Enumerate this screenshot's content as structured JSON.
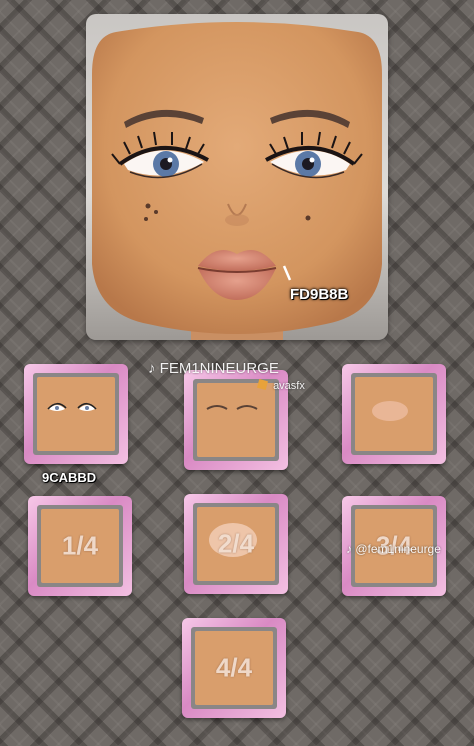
{
  "main_face": {
    "lip_color_code": "FD9B8B",
    "colors": {
      "skin": "#d99e6c",
      "lip": "#d27f6c",
      "iris": "#5b79a6"
    }
  },
  "tiles": [
    {
      "name": "eyes",
      "label": "9CABBD",
      "fraction": ""
    },
    {
      "name": "brows",
      "label": "",
      "fraction": ""
    },
    {
      "name": "nose-blush",
      "label": "",
      "fraction": ""
    },
    {
      "name": "quarter",
      "label": "",
      "fraction": "1/4"
    },
    {
      "name": "half",
      "label": "",
      "fraction": "2/4"
    },
    {
      "name": "three-quarter",
      "label": "",
      "fraction": "3/4"
    },
    {
      "name": "full",
      "label": "",
      "fraction": "4/4"
    }
  ],
  "watermarks": {
    "tiktok_center": "FEM1NINEURGE",
    "roblox_user": "avasfx",
    "tiktok_right": "@fem1nineurge"
  }
}
